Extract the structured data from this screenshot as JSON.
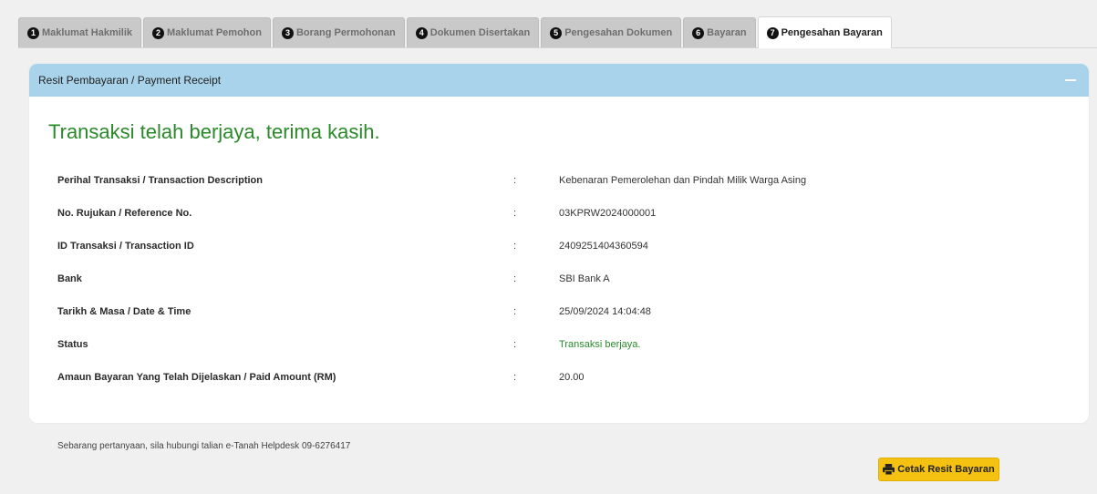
{
  "tabs": [
    {
      "num": "1",
      "label": "Maklumat Hakmilik"
    },
    {
      "num": "2",
      "label": "Maklumat Pemohon"
    },
    {
      "num": "3",
      "label": "Borang Permohonan"
    },
    {
      "num": "4",
      "label": "Dokumen Disertakan"
    },
    {
      "num": "5",
      "label": "Pengesahan Dokumen"
    },
    {
      "num": "6",
      "label": "Bayaran"
    },
    {
      "num": "7",
      "label": "Pengesahan Bayaran"
    }
  ],
  "panel": {
    "title": "Resit Pembayaran / Payment Receipt",
    "success_message": "Transaksi telah berjaya, terima kasih."
  },
  "rows": [
    {
      "label": "Perihal Transaksi / Transaction Description",
      "colon": ":",
      "value": "Kebenaran Pemerolehan dan Pindah Milik Warga Asing"
    },
    {
      "label": "No. Rujukan / Reference No.",
      "colon": ":",
      "value": "03KPRW2024000001"
    },
    {
      "label": "ID Transaksi / Transaction ID",
      "colon": ":",
      "value": "2409251404360594"
    },
    {
      "label": "Bank",
      "colon": ":",
      "value": "SBI Bank A"
    },
    {
      "label": "Tarikh & Masa / Date & Time",
      "colon": ":",
      "value": "25/09/2024 14:04:48"
    },
    {
      "label": "Status",
      "colon": ":",
      "value": "Transaksi berjaya."
    },
    {
      "label": "Amaun Bayaran Yang Telah Dijelaskan / Paid Amount (RM)",
      "colon": ":",
      "value": "20.00"
    }
  ],
  "footer": {
    "note": "Sebarang pertanyaan, sila hubungi talian e-Tanah Helpdesk 09-6276417",
    "print_label": "Cetak Resit Bayaran"
  },
  "colors": {
    "header_bg": "#a8d3ea",
    "success": "#2a8a2a",
    "button": "#f5c211"
  },
  "icons": {
    "print": "printer-icon",
    "collapse": "minus-icon"
  }
}
